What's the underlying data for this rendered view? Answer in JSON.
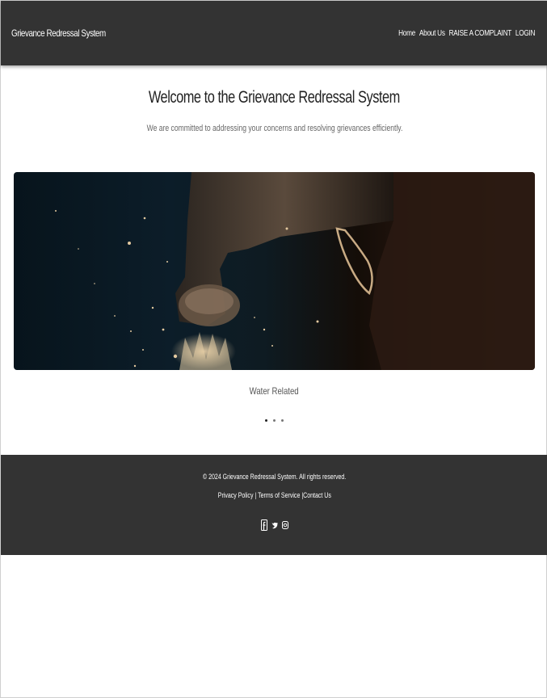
{
  "navbar": {
    "brand": "Grievance Redressal System",
    "links": [
      "Home",
      "About Us",
      "RAISE A COMPLAINT",
      "LOGIN"
    ]
  },
  "hero": {
    "title": "Welcome to the Grievance Redressal System",
    "subtitle": "We are committed to addressing your concerns and resolving grievances efficiently."
  },
  "carousel": {
    "caption": "Water Related",
    "slide_count": 3,
    "active_index": 0
  },
  "footer": {
    "copyright": "© 2024 Grievance Redressal System. All rights reserved.",
    "links": [
      "Privacy Policy",
      "Terms of Service",
      "Contact Us"
    ],
    "separator": "|",
    "social_icons": [
      "facebook-icon",
      "twitter-icon",
      "instagram-icon"
    ]
  }
}
